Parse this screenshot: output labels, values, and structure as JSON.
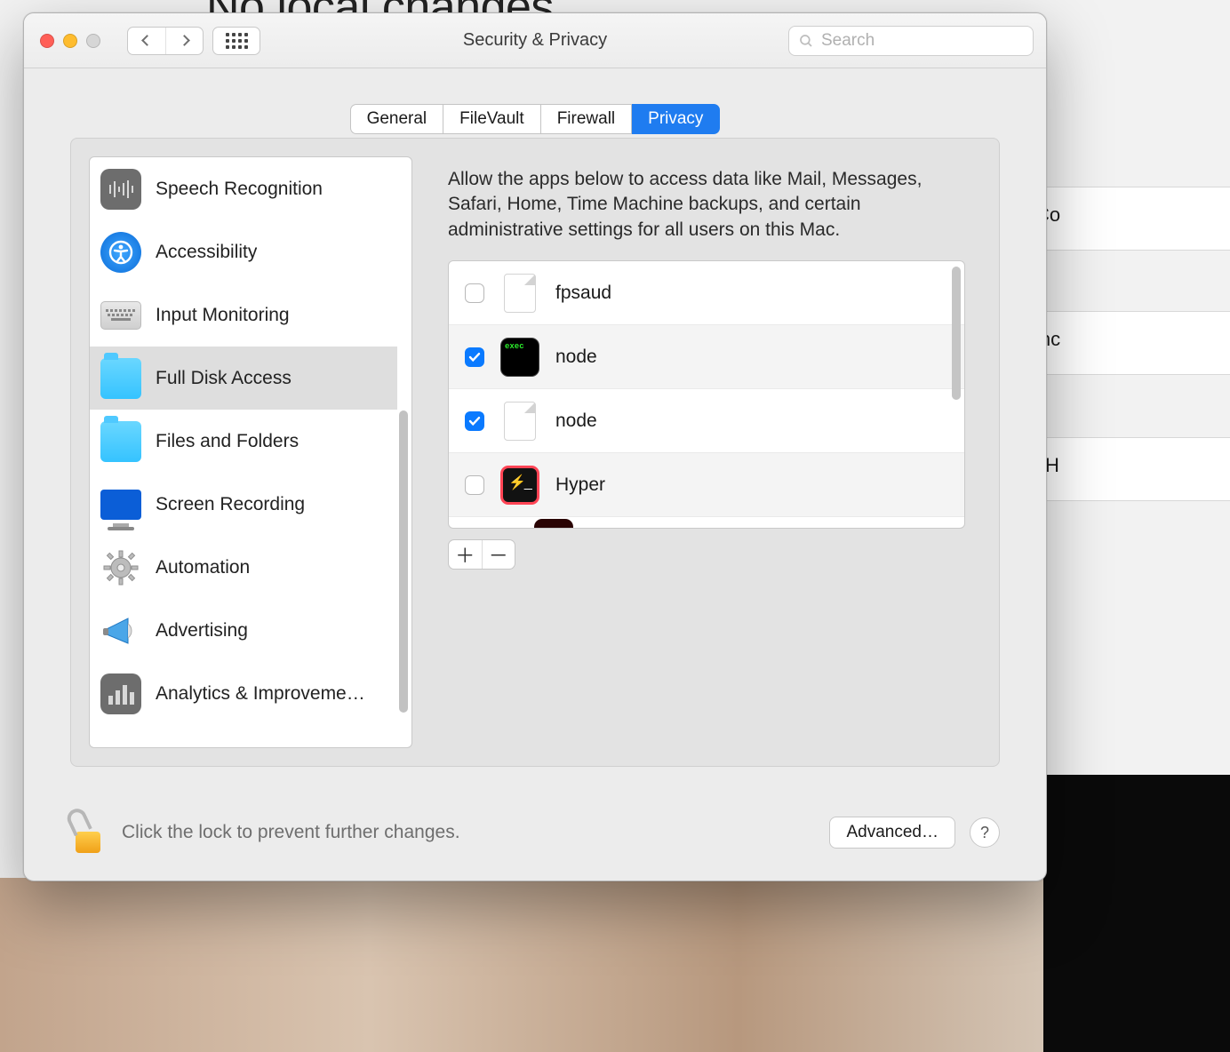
{
  "background": {
    "heading_fragment": "No local changes",
    "col1": "Co",
    "col2": "inc",
    "col3": "itH"
  },
  "window": {
    "title": "Security & Privacy",
    "search_placeholder": "Search",
    "tabs": [
      "General",
      "FileVault",
      "Firewall",
      "Privacy"
    ],
    "active_tab": "Privacy"
  },
  "sidebar": {
    "items": [
      {
        "label": "Speech Recognition",
        "icon": "waveform"
      },
      {
        "label": "Accessibility",
        "icon": "accessibility"
      },
      {
        "label": "Input Monitoring",
        "icon": "keyboard"
      },
      {
        "label": "Full Disk Access",
        "icon": "folder",
        "selected": true
      },
      {
        "label": "Files and Folders",
        "icon": "folder"
      },
      {
        "label": "Screen Recording",
        "icon": "display"
      },
      {
        "label": "Automation",
        "icon": "gear"
      },
      {
        "label": "Advertising",
        "icon": "megaphone"
      },
      {
        "label": "Analytics & Improveme…",
        "icon": "barchart"
      }
    ]
  },
  "detail": {
    "description": "Allow the apps below to access data like Mail, Messages, Safari, Home, Time Machine backups, and certain administrative settings for all users on this Mac.",
    "apps": [
      {
        "name": "fpsaud",
        "icon": "file",
        "checked": false
      },
      {
        "name": "node",
        "icon": "term",
        "checked": true
      },
      {
        "name": "node",
        "icon": "file",
        "checked": true
      },
      {
        "name": "Hyper",
        "icon": "hyper",
        "checked": false
      }
    ]
  },
  "footer": {
    "lock_message": "Click the lock to prevent further changes.",
    "advanced_label": "Advanced…",
    "help_label": "?"
  }
}
